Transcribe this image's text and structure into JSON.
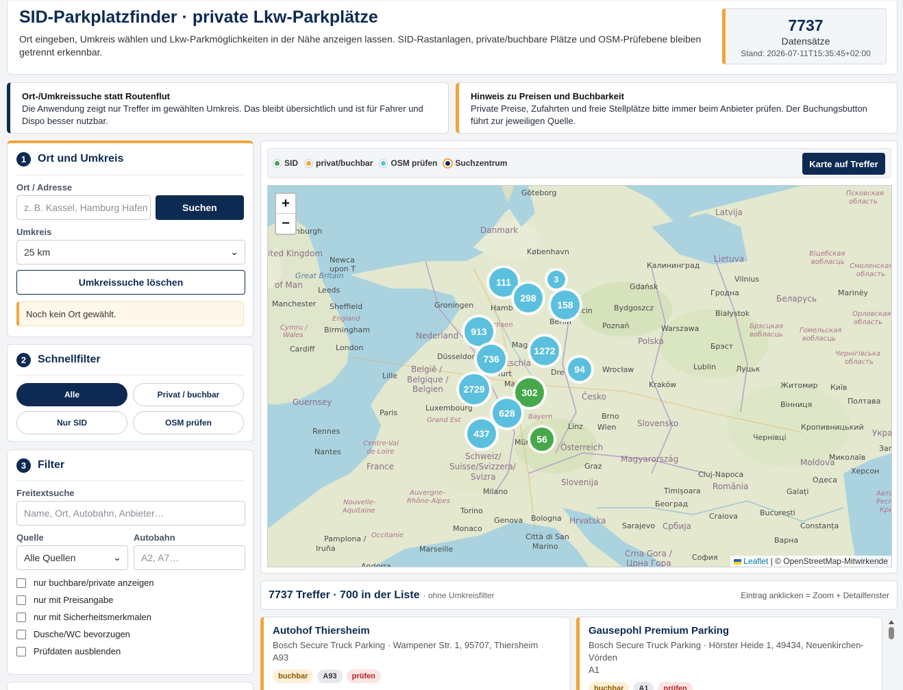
{
  "header": {
    "title": "SID-Parkplatzfinder · private Lkw-Parkplätze",
    "subtitle": "Ort eingeben, Umkreis wählen und Lkw-Parkmöglichkeiten in der Nähe anzeigen lassen. SID-Rastanlagen, private/buchbare Plätze und OSM-Prüfebene bleiben getrennt erkennbar.",
    "stats": {
      "count": "7737",
      "label": "Datensätze",
      "date": "Stand: 2026-07-11T15:35:45+02:00"
    }
  },
  "info_boxes": [
    {
      "title": "Ort-/Umkreissuche statt Routenflut",
      "text": "Die Anwendung zeigt nur Treffer im gewählten Umkreis. Das bleibt übersichtlich und ist für Fahrer und Dispo besser nutzbar."
    },
    {
      "title": "Hinweis zu Preisen und Buchbarkeit",
      "text": "Private Preise, Zufahrten und freie Stellplätze bitte immer beim Anbieter prüfen. Der Buchungsbutton führt zur jeweiligen Quelle."
    }
  ],
  "panel_location": {
    "number": "1",
    "title": "Ort und Umkreis",
    "address_label": "Ort / Adresse",
    "address_placeholder": "z. B. Kassel, Hamburg Hafen",
    "search_button": "Suchen",
    "radius_label": "Umkreis",
    "radius_value": "25 km",
    "clear_button": "Umkreissuche löschen",
    "note": "Noch kein Ort gewählt."
  },
  "panel_quick": {
    "number": "2",
    "title": "Schnellfilter",
    "buttons": [
      "Alle",
      "Privat / buchbar",
      "Nur SID",
      "OSM prüfen"
    ],
    "active": "Alle"
  },
  "panel_filter": {
    "number": "3",
    "title": "Filter",
    "freetext_label": "Freitextsuche",
    "freetext_placeholder": "Name, Ort, Autobahn, Anbieter…",
    "source_label": "Quelle",
    "source_value": "Alle Quellen",
    "motorway_label": "Autobahn",
    "motorway_placeholder": "A2, A7…",
    "checkboxes": [
      "nur buchbare/private anzeigen",
      "nur mit Preisangabe",
      "nur mit Sicherheitsmerkmalen",
      "Dusche/WC bevorzugen",
      "Prüfdaten ausblenden"
    ]
  },
  "legend": {
    "items": [
      {
        "label": "SID",
        "color": "#46a84a"
      },
      {
        "label": "privat/buchbar",
        "color": "#f0a63a"
      },
      {
        "label": "OSM prüfen",
        "color": "#5bc0de"
      },
      {
        "label": "Suchzentrum",
        "color": "#0d2a52"
      }
    ],
    "zoom_button": "Karte auf Treffer"
  },
  "map": {
    "zoom_in": "+",
    "zoom_out": "−",
    "clusters": [
      {
        "count": "111",
        "type": "osm"
      },
      {
        "count": "3",
        "type": "osm"
      },
      {
        "count": "298",
        "type": "osm"
      },
      {
        "count": "158",
        "type": "osm"
      },
      {
        "count": "913",
        "type": "osm"
      },
      {
        "count": "1272",
        "type": "osm"
      },
      {
        "count": "736",
        "type": "osm"
      },
      {
        "count": "94",
        "type": "osm"
      },
      {
        "count": "2729",
        "type": "osm"
      },
      {
        "count": "302",
        "type": "sid"
      },
      {
        "count": "628",
        "type": "osm"
      },
      {
        "count": "437",
        "type": "osm"
      },
      {
        "count": "56",
        "type": "sid"
      }
    ],
    "labels": {
      "goteborg": "Göteborg",
      "danmark": "Danmark",
      "kobenhavn": "København",
      "united_kingdom": "ited Kingdom",
      "newcastle": "Newca",
      "upon": "upon T",
      "great_britain": "Great Britain",
      "isle_of_man": "of Man",
      "leeds": "Leeds",
      "manchester": "Manchester",
      "sheffield": "Sheffield",
      "england": "England",
      "cymru": "Cymru /",
      "wales": "Wales",
      "birmingham": "Birmingham",
      "cardiff": "Cardiff",
      "london": "London",
      "edinburgh": "nburgh",
      "groningen": "Groningen",
      "hamburg": "Hamb",
      "nederland": "Nederland",
      "sachsen": "chsen",
      "dusseldorf": "Düsseldorf",
      "magdeburg": "Mag",
      "berlin": "Berlin",
      "stettin": "ecin",
      "deutschland": "tschla",
      "dresden": "Dre",
      "lille": "Lille",
      "belgique": "België /",
      "belgique2": "Belgique /",
      "belgien": "Belgien",
      "frankfurt": "furt",
      "main": "Main",
      "luxembourg": "Luxembourg",
      "guernsey": "Guernsey",
      "paris": "Paris",
      "grand_est": "Grand Est",
      "bayern": "Bayern",
      "rennes": "Rennes",
      "nantes": "Nantes",
      "centre": "Centre-Val",
      "loire": "de Loire",
      "france": "France",
      "schweiz": "Schweiz/",
      "suisse": "Suisse/Svizzera/",
      "svizra": "Svizra",
      "munchen": "Mün",
      "osterreich": "Österreich",
      "linz": "Linz",
      "wien": "Wien",
      "brno": "Brno",
      "cesko": "Česko",
      "auvergne": "Auvergne-",
      "rhone": "Rhône-Alpes",
      "nouvelle": "Nouvelle-",
      "aquitaine": "Aquitaine",
      "milano": "Milano",
      "torino": "Torino",
      "genova": "Genova",
      "bologna": "Bologna",
      "monaco": "Monaco",
      "occitanie": "Occitanie",
      "marseille": "Marseille",
      "pamplona": "Pamplona /",
      "iruna": "Iruña",
      "andorra": "Andorra",
      "citta": "Città di San",
      "marino": "Marino",
      "hrvatska": "Hrvatska",
      "slovenija": "Slovenija",
      "graz": "Graz",
      "magyarorszag": "Magyarország",
      "slovensko": "Slovensko",
      "polska": "Polska",
      "gdansk": "Gdańsk",
      "bydgoszcz": "Bydgoszcz",
      "poznan": "Poznań",
      "warszawa": "Warszawa",
      "wroclaw": "Wrocław",
      "krakow": "Kraków",
      "lublin": "Lublin",
      "kaliningrad": "Калининград",
      "lietuva": "Lietuva",
      "latvija": "Latvija",
      "vilnius": "Vilnius",
      "grodno": "Гродна",
      "belarus": "Беларусь",
      "bialystok": "Białystok",
      "brest": "Брэст",
      "lutsk": "Луцьк",
      "zhytomyr": "Житомир",
      "kyiv": "Київ",
      "vinnytsia": "Вінниця",
      "kropyvnytskyi": "Кропивницький",
      "chernivtsi": "Чернівці",
      "poltava": "Полтава",
      "cluj": "Cluj-Napoca",
      "romania": "România",
      "timisoara": "Timișoara",
      "moldova": "Moldova",
      "mykolaiv": "Миколаїв",
      "odesa": "Одеса",
      "kherson": "Херсон",
      "ukraine": "Украї",
      "zap": "Зап",
      "galati": "Galați",
      "bucuresti": "București",
      "constanta": "Constanța",
      "craiova": "Craiova",
      "varna": "Варна",
      "beograd": "Београд",
      "srbija": "Србија",
      "sarajevo": "Sarajevo",
      "crna_gora": "Crna Gora /",
      "crna_gora2": "Црна Гора",
      "sofia": "София",
      "pskov": "Псковская",
      "pskov2": "область",
      "vitebsk": "Віцебская",
      "vitebsk2": "вобласць",
      "smolensk": "Смоленская",
      "smolensk2": "область",
      "mariniy": "Marinёy",
      "gomel": "Гомельская",
      "gomel2": "вобласць",
      "brest_obl": "Брэсцкая",
      "brest_obl2": "вобласць",
      "chernihiv": "Чернігівська",
      "chernihiv2": "область",
      "orl": "Орловская",
      "orl2": "область",
      "avton": "Автон",
      "respub": "Респуб",
      "krym": "Крим"
    },
    "attribution_leaflet": "Leaflet",
    "attribution_rest": "| © OpenStreetMap-Mitwirkende"
  },
  "results": {
    "count": "7737 Treffer · 700 in der Liste",
    "filter_note": "· ohne Umkreisfilter",
    "hint": "Eintrag anklicken = Zoom + Detailfenster",
    "items": [
      {
        "title": "Autohof Thiersheim",
        "subtitle": "Bosch Secure Truck Parking · Wampener Str. 1, 95707, Thiersheim",
        "road": "A93",
        "tags": [
          "buchbar",
          "A93",
          "prüfen"
        ]
      },
      {
        "title": "Gausepohl Premium Parking",
        "subtitle": "Bosch Secure Truck Parking · Hörster Heide 1, 49434, Neuenkirchen-Vörden",
        "road": "A1",
        "tags": [
          "buchbar",
          "A1",
          "prüfen"
        ]
      }
    ]
  }
}
